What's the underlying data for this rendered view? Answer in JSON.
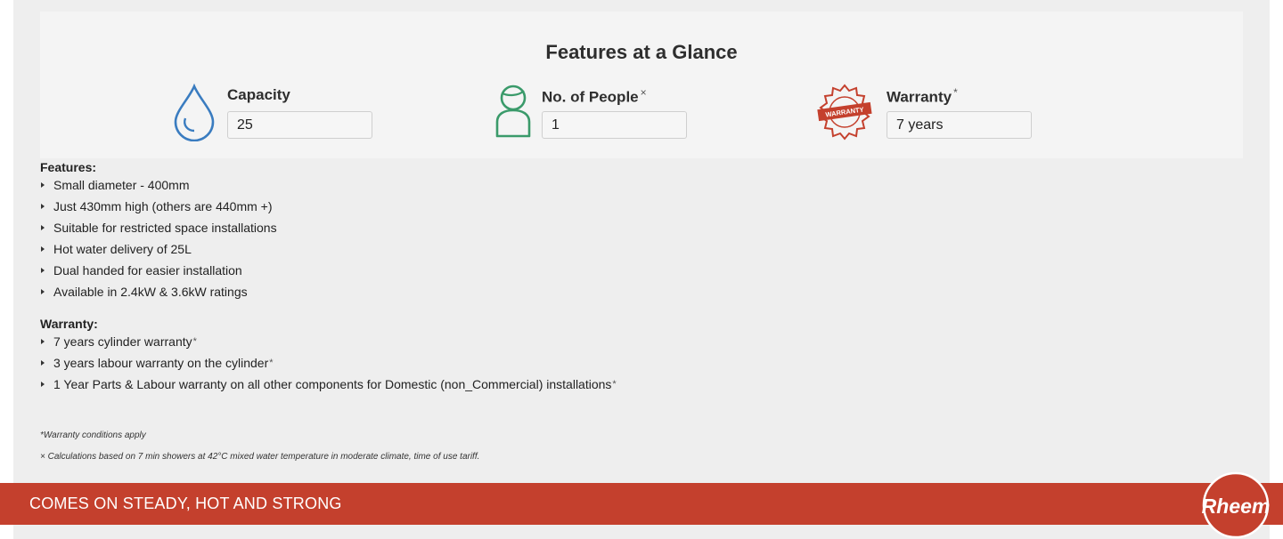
{
  "glance": {
    "title": "Features at a Glance",
    "capacity": {
      "label": "Capacity",
      "value": "25",
      "icon": "water-drop-icon",
      "color": "#3a7cc0"
    },
    "people": {
      "label": "No. of People",
      "mark": "×",
      "value": "1",
      "icon": "person-icon",
      "color": "#3a9a6a"
    },
    "warranty": {
      "label": "Warranty",
      "mark": "*",
      "value": "7 years",
      "icon": "warranty-badge-icon",
      "badge_text": "WARRANTY",
      "color": "#c4402d"
    }
  },
  "features": {
    "heading": "Features:",
    "items": [
      "Small diameter - 400mm",
      "Just 430mm high (others are 440mm +)",
      "Suitable for restricted space installations",
      "Hot water delivery of 25L",
      "Dual handed for easier installation",
      "Available in 2.4kW & 3.6kW ratings"
    ]
  },
  "warranty_section": {
    "heading": "Warranty:",
    "items": [
      {
        "text": "7 years cylinder warranty",
        "mark": "*"
      },
      {
        "text": "3 years labour warranty on the cylinder",
        "mark": "*"
      },
      {
        "text": "1 Year Parts & Labour warranty on all other components for Domestic (non_Commercial) installations",
        "mark": "*"
      }
    ]
  },
  "notes": {
    "warranty_note": "*Warranty conditions apply",
    "calc_note": "× Calculations based on 7 min showers at 42°C mixed water temperature in moderate climate, time of use tariff."
  },
  "banner": {
    "text": "COMES ON STEADY, HOT AND STRONG",
    "color": "#c4402d",
    "logo_text": "Rheem"
  }
}
